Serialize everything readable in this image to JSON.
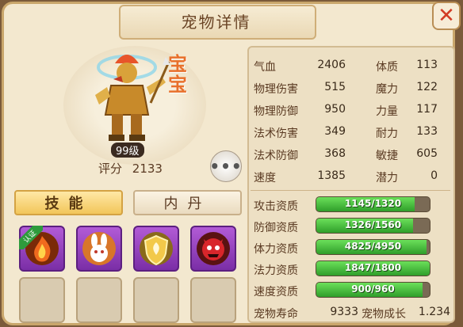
{
  "header": {
    "title": "宠物详情",
    "close_label": "✕"
  },
  "pet": {
    "badge": "宝宝",
    "level": "99级",
    "score_label": "评分",
    "score_value": "2133",
    "more_label": "•••"
  },
  "tabs": {
    "skills": "技能",
    "neidan": "内丹"
  },
  "skills": [
    {
      "name": "fire",
      "tag": "认证",
      "color": "#f06a1e"
    },
    {
      "name": "rabbit",
      "color": "#f2a84a"
    },
    {
      "name": "shield",
      "color": "#e6b23a"
    },
    {
      "name": "demon",
      "color": "#c8262b"
    }
  ],
  "stats": {
    "left": [
      {
        "label": "气血",
        "value": "2406"
      },
      {
        "label": "物理伤害",
        "value": "515"
      },
      {
        "label": "物理防御",
        "value": "950"
      },
      {
        "label": "法术伤害",
        "value": "349"
      },
      {
        "label": "法术防御",
        "value": "368"
      },
      {
        "label": "速度",
        "value": "1385"
      }
    ],
    "right": [
      {
        "label": "体质",
        "value": "113"
      },
      {
        "label": "魔力",
        "value": "122"
      },
      {
        "label": "力量",
        "value": "117"
      },
      {
        "label": "耐力",
        "value": "133"
      },
      {
        "label": "敏捷",
        "value": "605"
      },
      {
        "label": "潜力",
        "value": "0"
      }
    ]
  },
  "aptitudes": [
    {
      "label": "攻击资质",
      "text": "1145/1320",
      "fill": 0.867
    },
    {
      "label": "防御资质",
      "text": "1326/1560",
      "fill": 0.85
    },
    {
      "label": "体力资质",
      "text": "4825/4950",
      "fill": 0.975
    },
    {
      "label": "法力资质",
      "text": "1847/1800",
      "fill": 1.0
    },
    {
      "label": "速度资质",
      "text": "900/960",
      "fill": 0.9375
    }
  ],
  "footer": {
    "life_label": "宠物寿命",
    "life_value": "9333",
    "growth_label": "宠物成长",
    "growth_value": "1.234"
  }
}
